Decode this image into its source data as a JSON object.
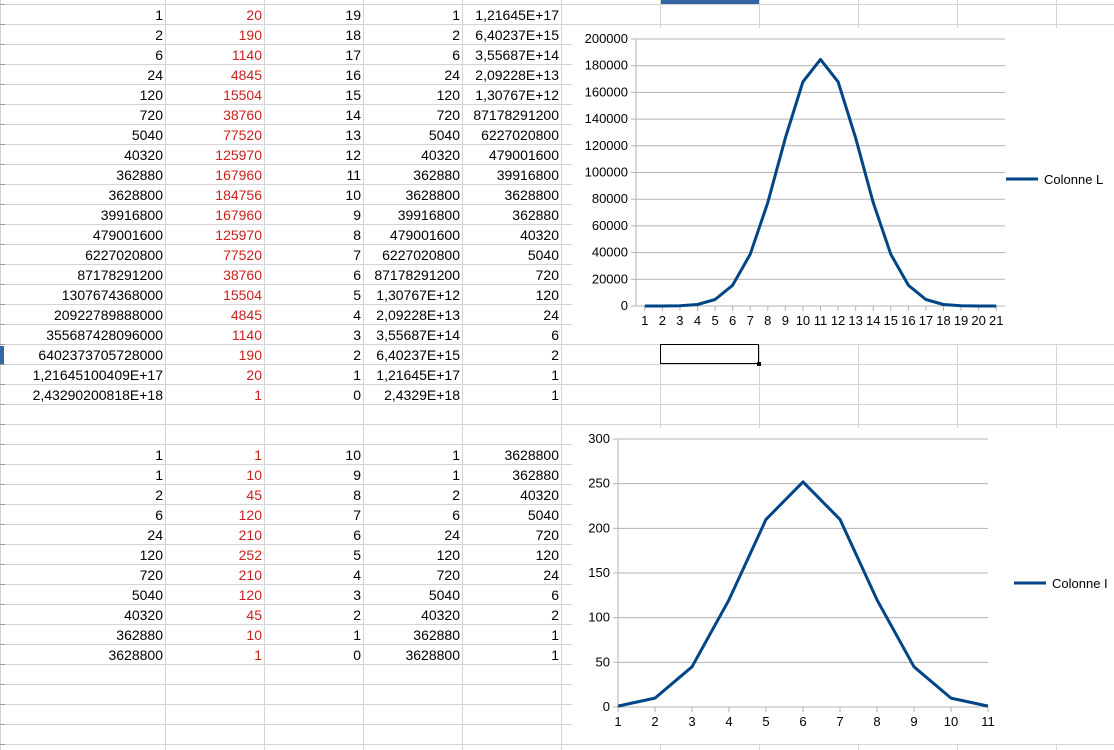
{
  "grid": {
    "block1": [
      [
        "1",
        "20",
        "19",
        "1",
        "1,21645E+17"
      ],
      [
        "2",
        "190",
        "18",
        "2",
        "6,40237E+15"
      ],
      [
        "6",
        "1140",
        "17",
        "6",
        "3,55687E+14"
      ],
      [
        "24",
        "4845",
        "16",
        "24",
        "2,09228E+13"
      ],
      [
        "120",
        "15504",
        "15",
        "120",
        "1,30767E+12"
      ],
      [
        "720",
        "38760",
        "14",
        "720",
        "87178291200"
      ],
      [
        "5040",
        "77520",
        "13",
        "5040",
        "6227020800"
      ],
      [
        "40320",
        "125970",
        "12",
        "40320",
        "479001600"
      ],
      [
        "362880",
        "167960",
        "11",
        "362880",
        "39916800"
      ],
      [
        "3628800",
        "184756",
        "10",
        "3628800",
        "3628800"
      ],
      [
        "39916800",
        "167960",
        "9",
        "39916800",
        "362880"
      ],
      [
        "479001600",
        "125970",
        "8",
        "479001600",
        "40320"
      ],
      [
        "6227020800",
        "77520",
        "7",
        "6227020800",
        "5040"
      ],
      [
        "87178291200",
        "38760",
        "6",
        "87178291200",
        "720"
      ],
      [
        "1307674368000",
        "15504",
        "5",
        "1,30767E+12",
        "120"
      ],
      [
        "20922789888000",
        "4845",
        "4",
        "2,09228E+13",
        "24"
      ],
      [
        "355687428096000",
        "1140",
        "3",
        "3,55687E+14",
        "6"
      ],
      [
        "6402373705728000",
        "190",
        "2",
        "6,40237E+15",
        "2"
      ],
      [
        "1,21645100409E+17",
        "20",
        "1",
        "1,21645E+17",
        "1"
      ],
      [
        "2,43290200818E+18",
        "1",
        "0",
        "2,4329E+18",
        "1"
      ]
    ],
    "block2": [
      [
        "1",
        "1",
        "10",
        "1",
        "3628800"
      ],
      [
        "1",
        "10",
        "9",
        "1",
        "362880"
      ],
      [
        "2",
        "45",
        "8",
        "2",
        "40320"
      ],
      [
        "6",
        "120",
        "7",
        "6",
        "5040"
      ],
      [
        "24",
        "210",
        "6",
        "24",
        "720"
      ],
      [
        "120",
        "252",
        "5",
        "120",
        "120"
      ],
      [
        "720",
        "210",
        "4",
        "720",
        "24"
      ],
      [
        "5040",
        "120",
        "3",
        "5040",
        "6"
      ],
      [
        "40320",
        "45",
        "2",
        "40320",
        "2"
      ],
      [
        "362880",
        "10",
        "1",
        "362880",
        "1"
      ],
      [
        "3628800",
        "1",
        "0",
        "3628800",
        "1"
      ]
    ]
  },
  "colors": {
    "series": "#004586",
    "red_text": "#c9211e",
    "gridline": "#d4d4d4",
    "selection": "#3465a4"
  },
  "chart_data": [
    {
      "type": "line",
      "x": [
        1,
        2,
        3,
        4,
        5,
        6,
        7,
        8,
        9,
        10,
        11,
        12,
        13,
        14,
        15,
        16,
        17,
        18,
        19,
        20,
        21
      ],
      "series": [
        {
          "name": "Colonne L",
          "values": [
            1,
            20,
            190,
            1140,
            4845,
            15504,
            38760,
            77520,
            125970,
            167960,
            184756,
            167960,
            125970,
            77520,
            38760,
            15504,
            4845,
            1140,
            190,
            20,
            1
          ]
        }
      ],
      "ylim": [
        0,
        200000
      ],
      "yticks": [
        0,
        20000,
        40000,
        60000,
        80000,
        100000,
        120000,
        140000,
        160000,
        180000,
        200000
      ],
      "xtick_labels": [
        "1",
        "2",
        "3",
        "4",
        "5",
        "6",
        "7",
        "8",
        "9",
        "10",
        "11",
        "12",
        "13",
        "14",
        "15",
        "16",
        "17",
        "18",
        "19",
        "20",
        "21"
      ],
      "ytick_labels": [
        "0",
        "20000",
        "40000",
        "60000",
        "80000",
        "100000",
        "120000",
        "140000",
        "160000",
        "180000",
        "200000"
      ],
      "grid": true,
      "legend": "right",
      "legend_label": "Colonne L"
    },
    {
      "type": "line",
      "x": [
        1,
        2,
        3,
        4,
        5,
        6,
        7,
        8,
        9,
        10,
        11
      ],
      "series": [
        {
          "name": "Colonne I",
          "values": [
            1,
            10,
            45,
            120,
            210,
            252,
            210,
            120,
            45,
            10,
            1
          ]
        }
      ],
      "ylim": [
        0,
        300
      ],
      "yticks": [
        0,
        50,
        100,
        150,
        200,
        250,
        300
      ],
      "xtick_labels": [
        "1",
        "2",
        "3",
        "4",
        "5",
        "6",
        "7",
        "8",
        "9",
        "10",
        "11"
      ],
      "ytick_labels": [
        "0",
        "50",
        "100",
        "150",
        "200",
        "250",
        "300"
      ],
      "grid": true,
      "legend": "right",
      "legend_label": "Colonne I"
    }
  ]
}
